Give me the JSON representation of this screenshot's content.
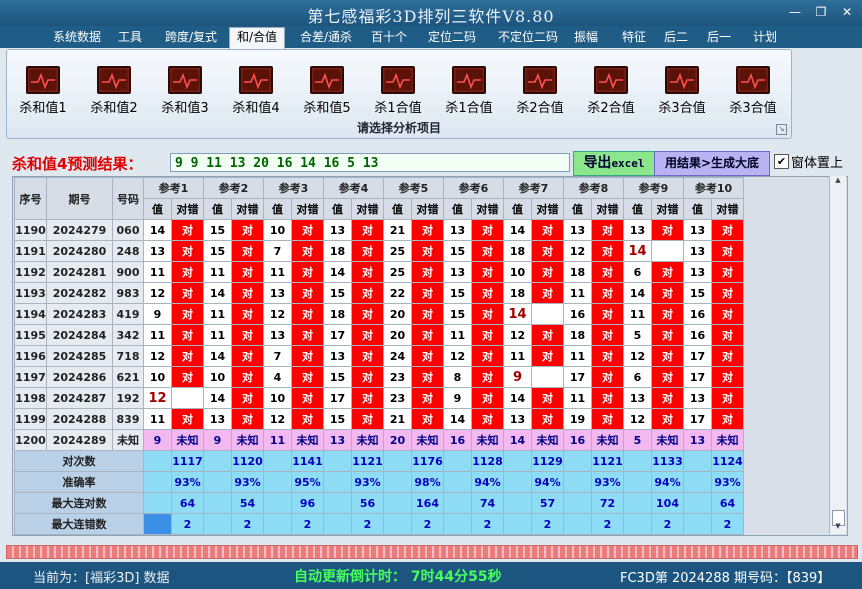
{
  "window": {
    "title": "第七感福彩3D排列三软件V8.80",
    "minimize": "—",
    "restore": "❐",
    "close": "✕"
  },
  "menu": [
    "系统数据",
    "工具",
    "跨度/复式",
    "和/合值",
    "合差/通杀",
    "百十个",
    "定位二码",
    "不定位二码",
    "振幅",
    "特征",
    "后二",
    "后一",
    "计划"
  ],
  "menu_active": "和/合值",
  "ribbon": {
    "buttons": [
      "杀和值1",
      "杀和值2",
      "杀和值3",
      "杀和值4",
      "杀和值5",
      "杀1合值",
      "杀1合值",
      "杀2合值",
      "杀2合值",
      "杀3合值",
      "杀3合值"
    ],
    "caption": "请选择分析项目",
    "button_icon": "chart-icon"
  },
  "prediction": {
    "label": "杀和值4预测结果：",
    "value": "9  9  11  13  20  16  14  16  5  13",
    "excel_main": "导出",
    "excel_sub": "excel",
    "generate": "用结果>生成大底",
    "pin_check": "✔",
    "pin_label": "窗体置上"
  },
  "table": {
    "h_idx": "序号",
    "h_period": "期号",
    "h_num": "号码",
    "sub_value": "值",
    "sub_check": "对错",
    "refs": [
      "参考1",
      "参考2",
      "参考3",
      "参考4",
      "参考5",
      "参考6",
      "参考7",
      "参考8",
      "参考9",
      "参考10"
    ],
    "rows": [
      {
        "idx": "1190",
        "period": "2024279",
        "num": "060",
        "values": [
          "14",
          "15",
          "10",
          "13",
          "21",
          "13",
          "14",
          "13",
          "13",
          "13"
        ],
        "checks": [
          "对",
          "对",
          "对",
          "对",
          "对",
          "对",
          "对",
          "对",
          "对",
          "对"
        ]
      },
      {
        "idx": "1191",
        "period": "2024280",
        "num": "248",
        "values": [
          "13",
          "15",
          "7",
          "18",
          "25",
          "15",
          "18",
          "12",
          "14",
          "13"
        ],
        "checks": [
          "对",
          "对",
          "对",
          "对",
          "对",
          "对",
          "对",
          "对",
          "",
          "对"
        ]
      },
      {
        "idx": "1192",
        "period": "2024281",
        "num": "900",
        "values": [
          "11",
          "11",
          "11",
          "14",
          "25",
          "13",
          "10",
          "18",
          "6",
          "13"
        ],
        "checks": [
          "对",
          "对",
          "对",
          "对",
          "对",
          "对",
          "对",
          "对",
          "对",
          "对"
        ]
      },
      {
        "idx": "1193",
        "period": "2024282",
        "num": "983",
        "values": [
          "12",
          "14",
          "13",
          "15",
          "22",
          "15",
          "18",
          "11",
          "14",
          "15"
        ],
        "checks": [
          "对",
          "对",
          "对",
          "对",
          "对",
          "对",
          "对",
          "对",
          "对",
          "对"
        ]
      },
      {
        "idx": "1194",
        "period": "2024283",
        "num": "419",
        "values": [
          "9",
          "11",
          "12",
          "18",
          "20",
          "15",
          "14",
          "16",
          "11",
          "16"
        ],
        "checks": [
          "对",
          "对",
          "对",
          "对",
          "对",
          "对",
          "",
          "对",
          "对",
          "对"
        ]
      },
      {
        "idx": "1195",
        "period": "2024284",
        "num": "342",
        "values": [
          "11",
          "11",
          "13",
          "17",
          "20",
          "11",
          "12",
          "18",
          "5",
          "16"
        ],
        "checks": [
          "对",
          "对",
          "对",
          "对",
          "对",
          "对",
          "对",
          "对",
          "对",
          "对"
        ]
      },
      {
        "idx": "1196",
        "period": "2024285",
        "num": "718",
        "values": [
          "12",
          "14",
          "7",
          "13",
          "24",
          "12",
          "11",
          "11",
          "12",
          "17"
        ],
        "checks": [
          "对",
          "对",
          "对",
          "对",
          "对",
          "对",
          "对",
          "对",
          "对",
          "对"
        ]
      },
      {
        "idx": "1197",
        "period": "2024286",
        "num": "621",
        "values": [
          "10",
          "10",
          "4",
          "15",
          "23",
          "8",
          "9",
          "17",
          "6",
          "17"
        ],
        "checks": [
          "对",
          "对",
          "对",
          "对",
          "对",
          "对",
          "",
          "对",
          "对",
          "对"
        ]
      },
      {
        "idx": "1198",
        "period": "2024287",
        "num": "192",
        "values": [
          "12",
          "14",
          "10",
          "17",
          "23",
          "9",
          "14",
          "11",
          "13",
          "13"
        ],
        "checks": [
          "",
          "对",
          "对",
          "对",
          "对",
          "对",
          "对",
          "对",
          "对",
          "对"
        ]
      },
      {
        "idx": "1199",
        "period": "2024288",
        "num": "839",
        "values": [
          "11",
          "13",
          "12",
          "15",
          "21",
          "14",
          "13",
          "19",
          "12",
          "17"
        ],
        "checks": [
          "对",
          "对",
          "对",
          "对",
          "对",
          "对",
          "对",
          "对",
          "对",
          "对"
        ]
      }
    ],
    "predict_row": {
      "idx": "1200",
      "period": "2024289",
      "num": "未知",
      "values": [
        "9",
        "9",
        "11",
        "13",
        "20",
        "16",
        "14",
        "16",
        "5",
        "13"
      ],
      "checks": [
        "未知",
        "未知",
        "未知",
        "未知",
        "未知",
        "未知",
        "未知",
        "未知",
        "未知",
        "未知"
      ]
    },
    "stats": [
      {
        "label": "对次数",
        "values": [
          "1117",
          "1120",
          "1141",
          "1121",
          "1176",
          "1128",
          "1129",
          "1121",
          "1133",
          "1124"
        ]
      },
      {
        "label": "准确率",
        "values": [
          "93%",
          "93%",
          "95%",
          "93%",
          "98%",
          "94%",
          "94%",
          "93%",
          "94%",
          "93%"
        ]
      },
      {
        "label": "最大连对数",
        "values": [
          "64",
          "54",
          "96",
          "56",
          "164",
          "74",
          "57",
          "72",
          "104",
          "64"
        ]
      },
      {
        "label": "最大连错数",
        "values": [
          "2",
          "2",
          "2",
          "2",
          "2",
          "2",
          "2",
          "2",
          "2",
          "2"
        ]
      }
    ]
  },
  "status": {
    "left": "当前为：[福彩3D] 数据",
    "countdown": "自动更新倒计时：  7时44分55秒",
    "right": "FC3D第 2024288 期号码：【839】"
  }
}
